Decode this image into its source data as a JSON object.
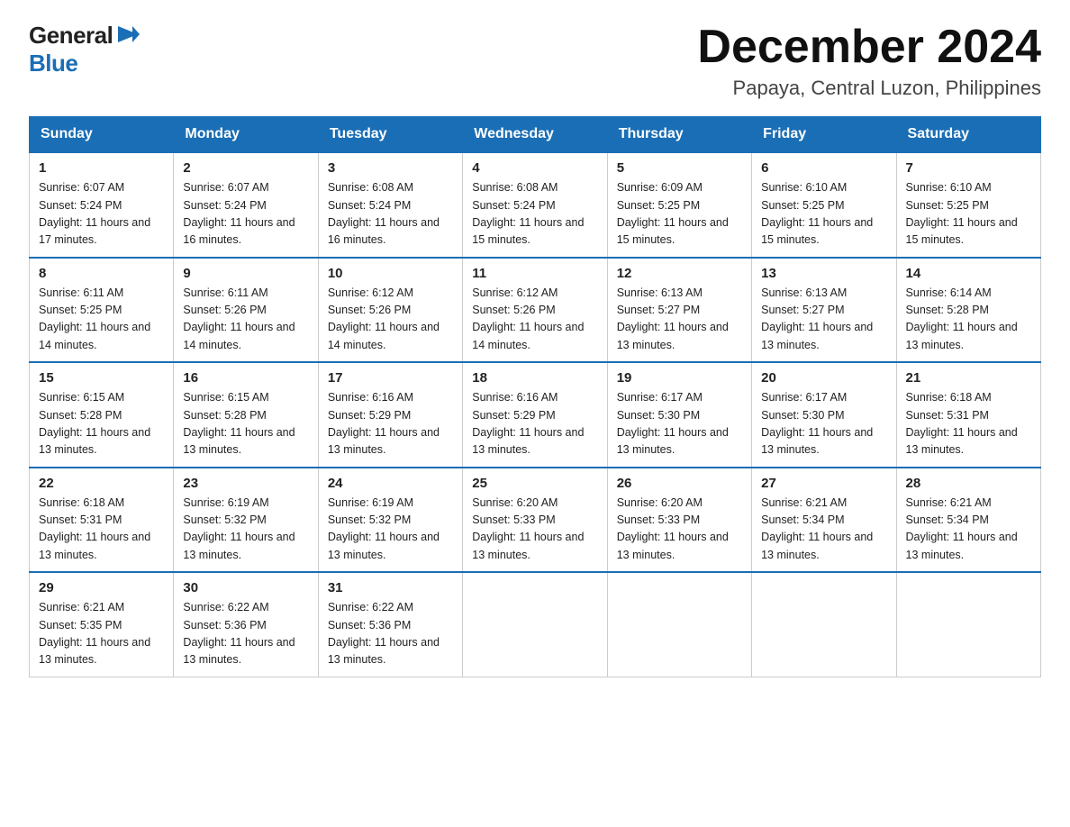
{
  "header": {
    "logo_general": "General",
    "logo_flag": "▶",
    "logo_blue": "Blue",
    "title": "December 2024",
    "location": "Papaya, Central Luzon, Philippines"
  },
  "weekdays": [
    "Sunday",
    "Monday",
    "Tuesday",
    "Wednesday",
    "Thursday",
    "Friday",
    "Saturday"
  ],
  "weeks": [
    [
      {
        "day": "1",
        "sunrise": "6:07 AM",
        "sunset": "5:24 PM",
        "daylight": "11 hours and 17 minutes."
      },
      {
        "day": "2",
        "sunrise": "6:07 AM",
        "sunset": "5:24 PM",
        "daylight": "11 hours and 16 minutes."
      },
      {
        "day": "3",
        "sunrise": "6:08 AM",
        "sunset": "5:24 PM",
        "daylight": "11 hours and 16 minutes."
      },
      {
        "day": "4",
        "sunrise": "6:08 AM",
        "sunset": "5:24 PM",
        "daylight": "11 hours and 15 minutes."
      },
      {
        "day": "5",
        "sunrise": "6:09 AM",
        "sunset": "5:25 PM",
        "daylight": "11 hours and 15 minutes."
      },
      {
        "day": "6",
        "sunrise": "6:10 AM",
        "sunset": "5:25 PM",
        "daylight": "11 hours and 15 minutes."
      },
      {
        "day": "7",
        "sunrise": "6:10 AM",
        "sunset": "5:25 PM",
        "daylight": "11 hours and 15 minutes."
      }
    ],
    [
      {
        "day": "8",
        "sunrise": "6:11 AM",
        "sunset": "5:25 PM",
        "daylight": "11 hours and 14 minutes."
      },
      {
        "day": "9",
        "sunrise": "6:11 AM",
        "sunset": "5:26 PM",
        "daylight": "11 hours and 14 minutes."
      },
      {
        "day": "10",
        "sunrise": "6:12 AM",
        "sunset": "5:26 PM",
        "daylight": "11 hours and 14 minutes."
      },
      {
        "day": "11",
        "sunrise": "6:12 AM",
        "sunset": "5:26 PM",
        "daylight": "11 hours and 14 minutes."
      },
      {
        "day": "12",
        "sunrise": "6:13 AM",
        "sunset": "5:27 PM",
        "daylight": "11 hours and 13 minutes."
      },
      {
        "day": "13",
        "sunrise": "6:13 AM",
        "sunset": "5:27 PM",
        "daylight": "11 hours and 13 minutes."
      },
      {
        "day": "14",
        "sunrise": "6:14 AM",
        "sunset": "5:28 PM",
        "daylight": "11 hours and 13 minutes."
      }
    ],
    [
      {
        "day": "15",
        "sunrise": "6:15 AM",
        "sunset": "5:28 PM",
        "daylight": "11 hours and 13 minutes."
      },
      {
        "day": "16",
        "sunrise": "6:15 AM",
        "sunset": "5:28 PM",
        "daylight": "11 hours and 13 minutes."
      },
      {
        "day": "17",
        "sunrise": "6:16 AM",
        "sunset": "5:29 PM",
        "daylight": "11 hours and 13 minutes."
      },
      {
        "day": "18",
        "sunrise": "6:16 AM",
        "sunset": "5:29 PM",
        "daylight": "11 hours and 13 minutes."
      },
      {
        "day": "19",
        "sunrise": "6:17 AM",
        "sunset": "5:30 PM",
        "daylight": "11 hours and 13 minutes."
      },
      {
        "day": "20",
        "sunrise": "6:17 AM",
        "sunset": "5:30 PM",
        "daylight": "11 hours and 13 minutes."
      },
      {
        "day": "21",
        "sunrise": "6:18 AM",
        "sunset": "5:31 PM",
        "daylight": "11 hours and 13 minutes."
      }
    ],
    [
      {
        "day": "22",
        "sunrise": "6:18 AM",
        "sunset": "5:31 PM",
        "daylight": "11 hours and 13 minutes."
      },
      {
        "day": "23",
        "sunrise": "6:19 AM",
        "sunset": "5:32 PM",
        "daylight": "11 hours and 13 minutes."
      },
      {
        "day": "24",
        "sunrise": "6:19 AM",
        "sunset": "5:32 PM",
        "daylight": "11 hours and 13 minutes."
      },
      {
        "day": "25",
        "sunrise": "6:20 AM",
        "sunset": "5:33 PM",
        "daylight": "11 hours and 13 minutes."
      },
      {
        "day": "26",
        "sunrise": "6:20 AM",
        "sunset": "5:33 PM",
        "daylight": "11 hours and 13 minutes."
      },
      {
        "day": "27",
        "sunrise": "6:21 AM",
        "sunset": "5:34 PM",
        "daylight": "11 hours and 13 minutes."
      },
      {
        "day": "28",
        "sunrise": "6:21 AM",
        "sunset": "5:34 PM",
        "daylight": "11 hours and 13 minutes."
      }
    ],
    [
      {
        "day": "29",
        "sunrise": "6:21 AM",
        "sunset": "5:35 PM",
        "daylight": "11 hours and 13 minutes."
      },
      {
        "day": "30",
        "sunrise": "6:22 AM",
        "sunset": "5:36 PM",
        "daylight": "11 hours and 13 minutes."
      },
      {
        "day": "31",
        "sunrise": "6:22 AM",
        "sunset": "5:36 PM",
        "daylight": "11 hours and 13 minutes."
      },
      null,
      null,
      null,
      null
    ]
  ]
}
